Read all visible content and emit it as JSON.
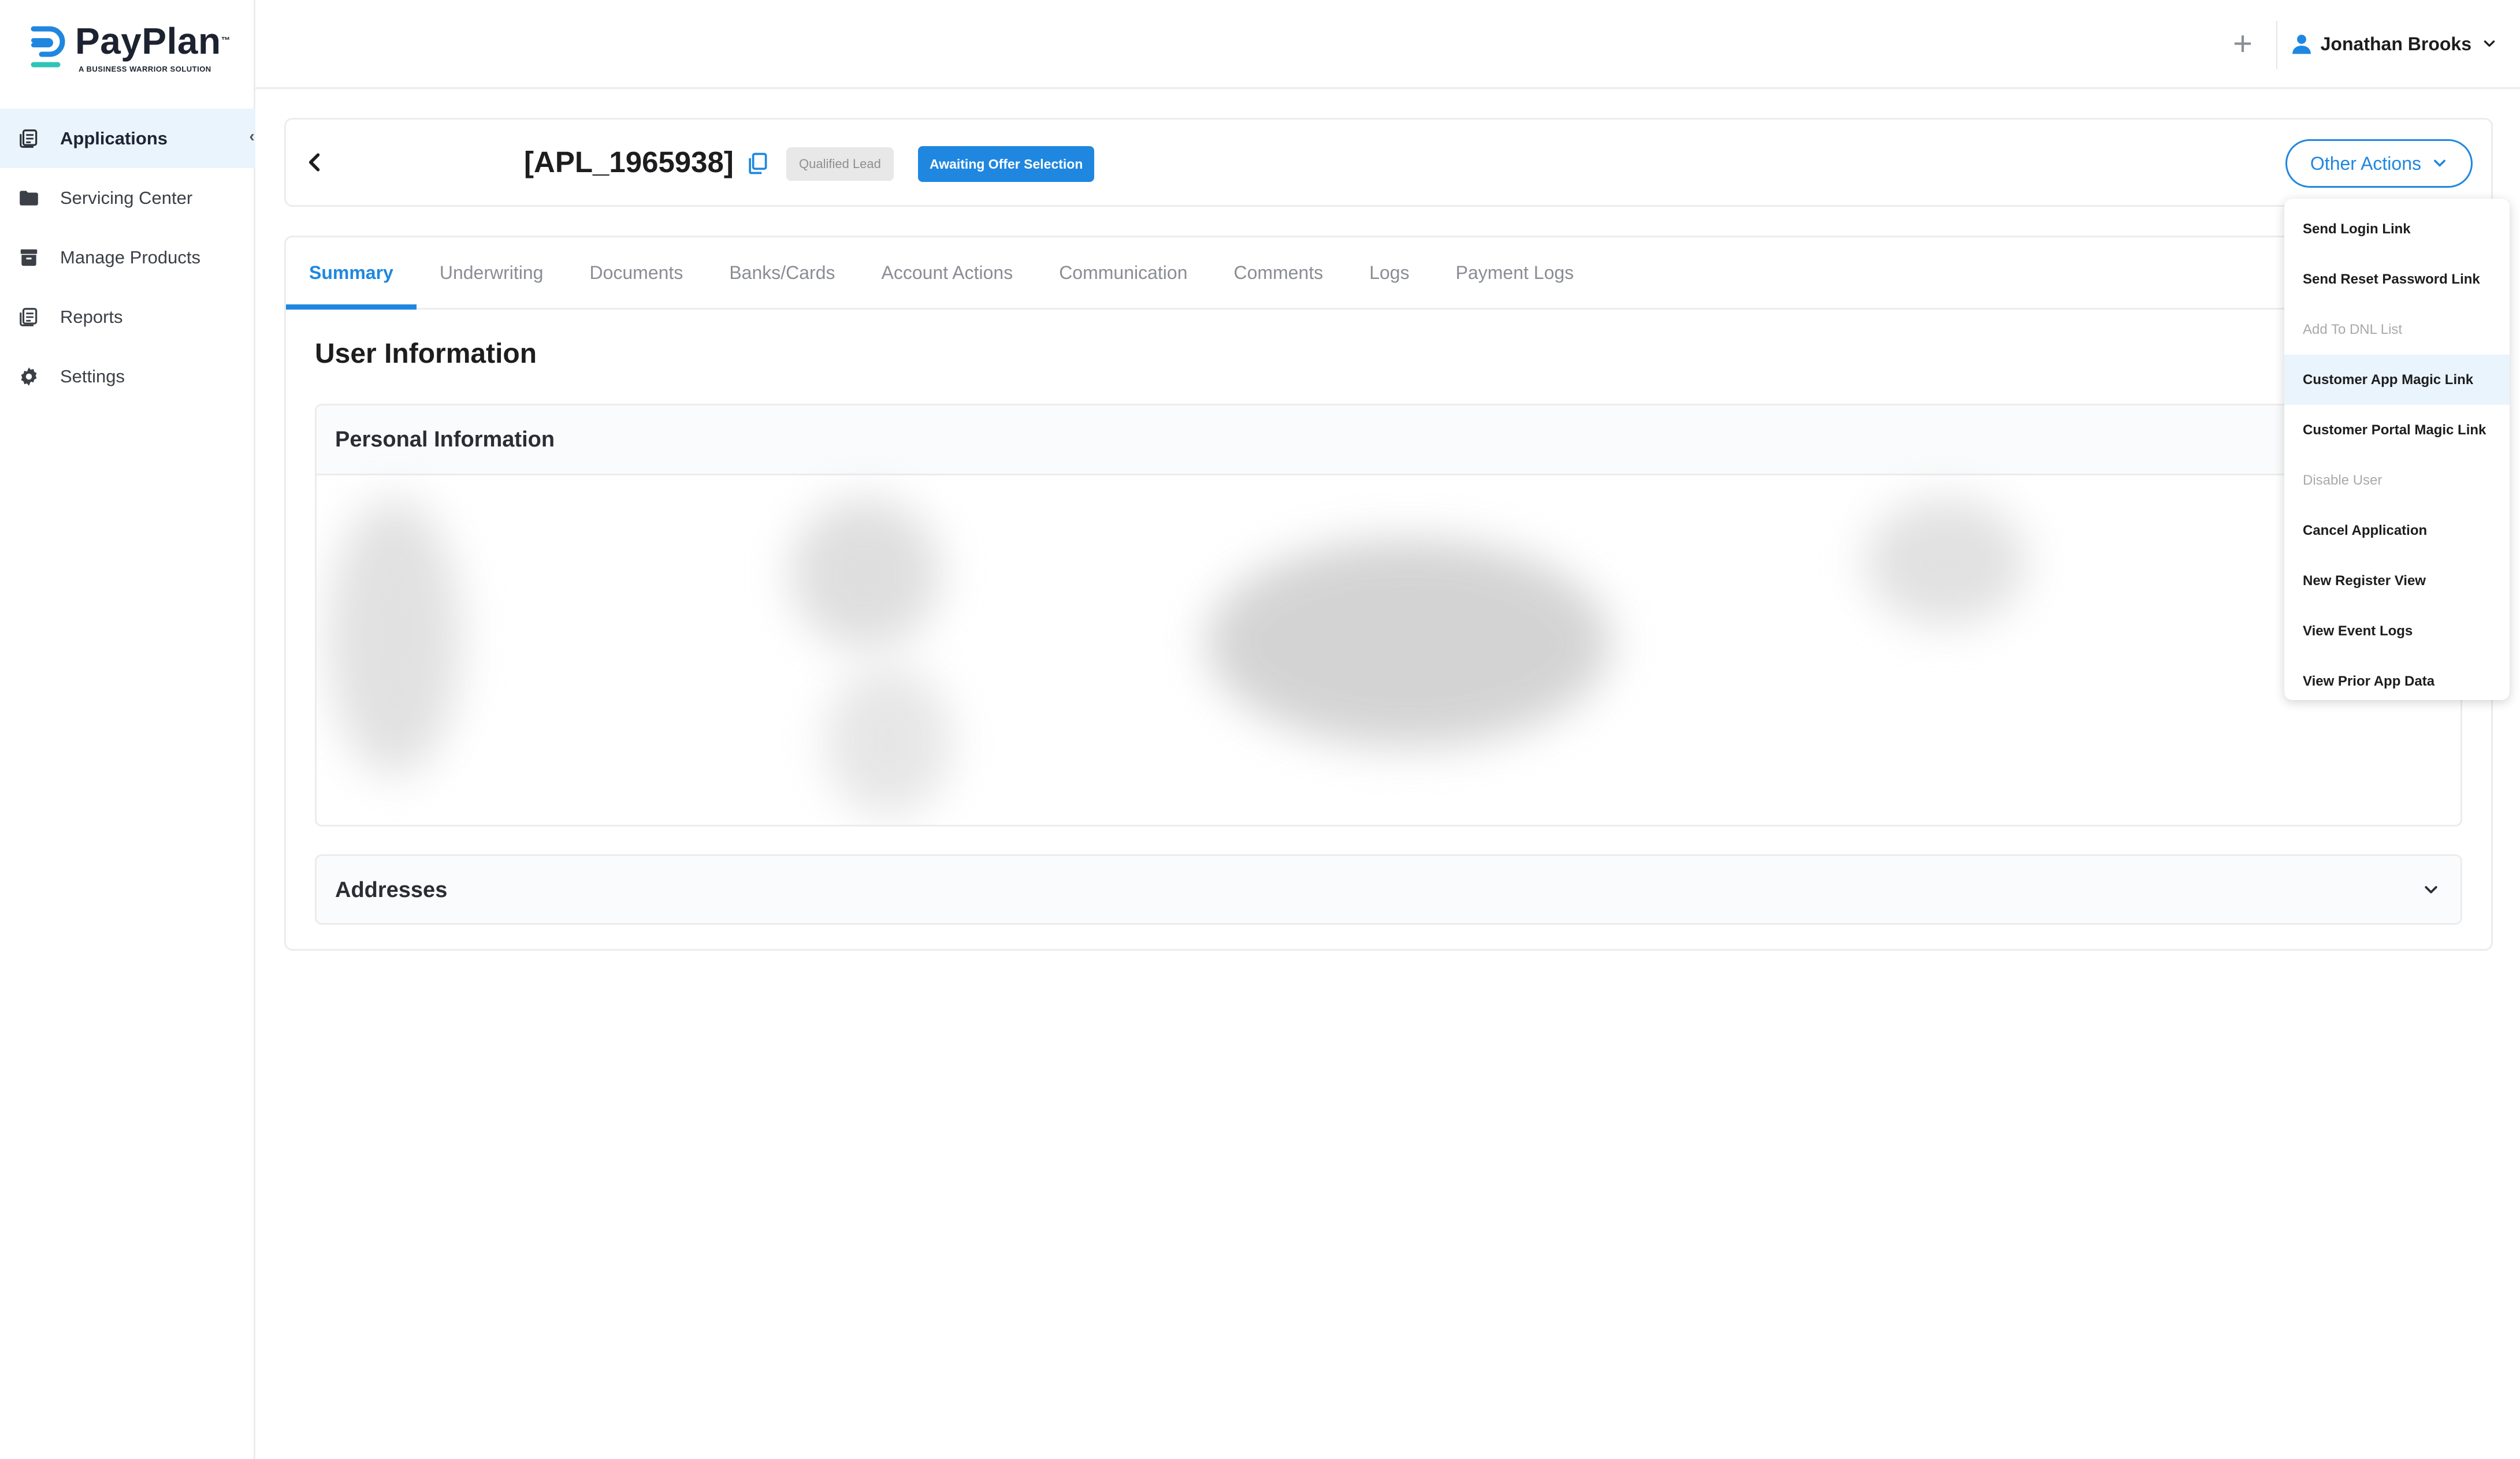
{
  "brand": {
    "name": "PayPlan",
    "tagline": "A BUSINESS WARRIOR SOLUTION"
  },
  "sidebar": {
    "items": [
      {
        "label": "Applications",
        "icon": "document-stack-icon",
        "active": true
      },
      {
        "label": "Servicing Center",
        "icon": "folder-icon",
        "active": false
      },
      {
        "label": "Manage Products",
        "icon": "archive-box-icon",
        "active": false
      },
      {
        "label": "Reports",
        "icon": "report-icon",
        "active": false
      },
      {
        "label": "Settings",
        "icon": "gear-icon",
        "active": false
      }
    ]
  },
  "header": {
    "user_name": "Jonathan Brooks"
  },
  "application": {
    "id": "[APL_1965938]",
    "badge_lead": "Qualified Lead",
    "badge_status": "Awaiting Offer Selection",
    "other_actions_label": "Other Actions"
  },
  "other_actions_menu": [
    {
      "label": "Send Login Link",
      "disabled": false
    },
    {
      "label": "Send Reset Password Link",
      "disabled": false
    },
    {
      "label": "Add To DNL List",
      "disabled": true
    },
    {
      "label": "Customer App Magic Link",
      "disabled": false,
      "hovered": true
    },
    {
      "label": "Customer Portal Magic Link",
      "disabled": false
    },
    {
      "label": "Disable User",
      "disabled": true
    },
    {
      "label": "Cancel Application",
      "disabled": false
    },
    {
      "label": "New Register View",
      "disabled": false
    },
    {
      "label": "View Event Logs",
      "disabled": false
    },
    {
      "label": "View Prior App Data",
      "disabled": false
    }
  ],
  "tabs": [
    {
      "label": "Summary",
      "active": true
    },
    {
      "label": "Underwriting"
    },
    {
      "label": "Documents"
    },
    {
      "label": "Banks/Cards"
    },
    {
      "label": "Account Actions"
    },
    {
      "label": "Communication"
    },
    {
      "label": "Comments"
    },
    {
      "label": "Logs"
    },
    {
      "label": "Payment Logs"
    }
  ],
  "summary": {
    "section_title": "User Information",
    "personal_info_title": "Personal Information",
    "addresses_title": "Addresses"
  },
  "colors": {
    "accent": "#1f87e0",
    "active_bg": "#eaf4fd",
    "logo_teal": "#2ec4b6"
  }
}
